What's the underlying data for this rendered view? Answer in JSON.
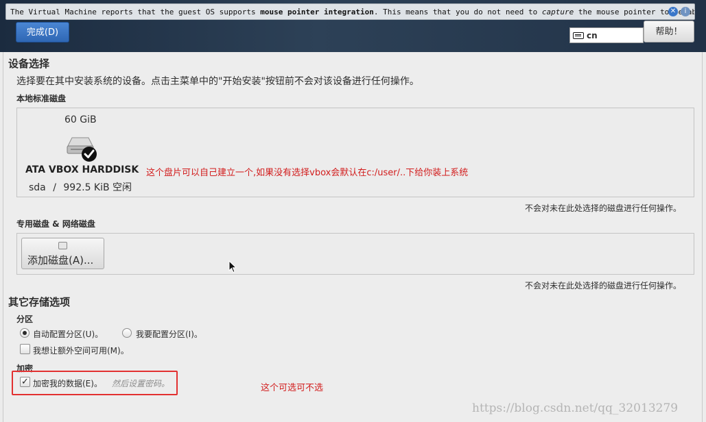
{
  "notice": {
    "text_part1": "The Virtual Machine reports that the guest OS supports ",
    "text_bold": "mouse pointer integration",
    "text_part2": ". This means that you do not need to ",
    "text_italic": "capture",
    "text_part3": " the mouse pointer to be able"
  },
  "header": {
    "done_label": "完成(D)",
    "keyboard_layout": "cn",
    "help_label": "帮助！"
  },
  "device_selection": {
    "title": "设备选择",
    "description": "选择要在其中安装系统的设备。点击主菜单中的\"开始安装\"按钮前不会对该设备进行任何操作。",
    "local_disks_title": "本地标准磁盘",
    "disk": {
      "size": "60 GiB",
      "name": "ATA VBOX HARDDISK",
      "device": "sda",
      "separator": "/",
      "free": "992.5 KiB 空闲"
    },
    "annotation": "这个盘片可以自己建立一个,如果没有选择vbox会默认在c:/user/..下给你装上系统",
    "unselected_note": "不会对未在此处选择的磁盘进行任何操作。",
    "specialized_title": "专用磁盘 & 网络磁盘",
    "add_disk_label": "添加磁盘(A)...",
    "unselected_note2": "不会对未在此处选择的磁盘进行任何操作。"
  },
  "other_options": {
    "title": "其它存储选项",
    "partition_title": "分区",
    "auto_partition": "自动配置分区(U)。",
    "manual_partition": "我要配置分区(I)。",
    "extra_space": "我想让额外空间可用(M)。",
    "encryption_title": "加密",
    "encrypt_data": "加密我的数据(E)。",
    "encrypt_hint": "然后设置密码。",
    "encrypt_annotation": "这个可选可不选"
  },
  "state": {
    "auto_partition_selected": true,
    "extra_space_checked": false,
    "encrypt_checked": true
  },
  "watermark": "https://blog.csdn.net/qq_32013279"
}
